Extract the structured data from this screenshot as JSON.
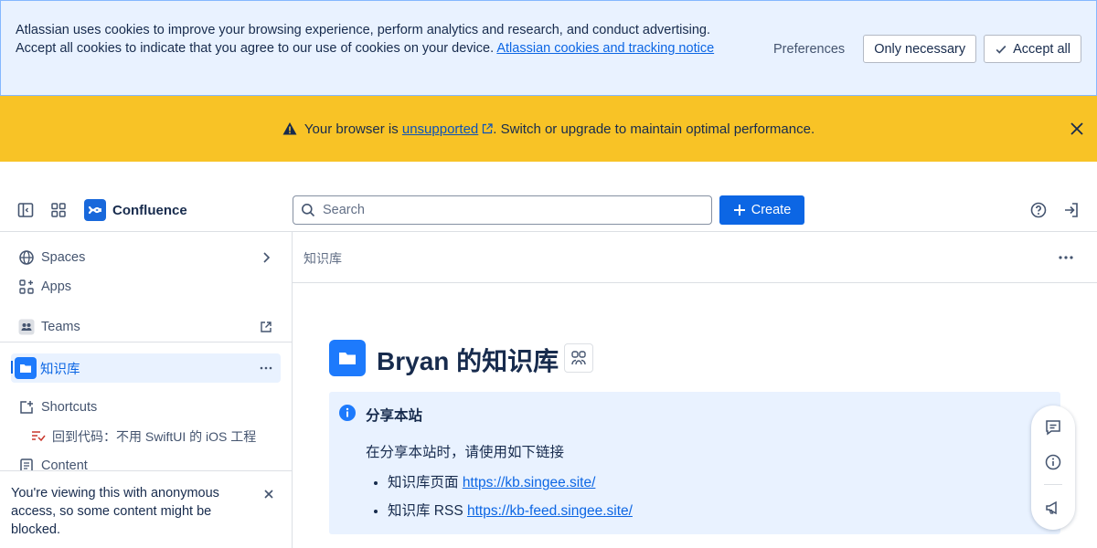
{
  "cookie_banner": {
    "text": "Atlassian uses cookies to improve your browsing experience, perform analytics and research, and conduct advertising. Accept all cookies to indicate that you agree to our use of cookies on your device.",
    "link": "Atlassian cookies and tracking notice",
    "preferences": "Preferences",
    "only_necessary": "Only necessary",
    "accept_all": "Accept all"
  },
  "warning": {
    "prefix": "Your browser is",
    "link": "unsupported",
    "suffix": ". Switch or upgrade to maintain optimal performance."
  },
  "nav": {
    "app_name": "Confluence",
    "search_placeholder": "Search",
    "create_label": "Create"
  },
  "sidebar": {
    "spaces": "Spaces",
    "apps": "Apps",
    "teams": "Teams",
    "space_name": "知识库",
    "shortcuts": "Shortcuts",
    "shortcut_item": "回到代码：不用 SwiftUI 的 iOS 工程",
    "content": "Content",
    "notice": "You're viewing this with anonymous access, so some content might be blocked."
  },
  "main": {
    "breadcrumb": "知识库",
    "title": "Bryan 的知识库",
    "panel": {
      "title": "分享本站",
      "desc": "在分享本站时，请使用如下链接",
      "items": [
        {
          "label": "知识库页面 ",
          "link": "https://kb.singee.site/"
        },
        {
          "label": "知识库 RSS ",
          "link": "https://kb-feed.singee.site/"
        }
      ]
    }
  },
  "colors": {
    "accent": "#0c66e4",
    "warning_bg": "#f8c326",
    "cookie_bg": "#e9f2ff"
  }
}
